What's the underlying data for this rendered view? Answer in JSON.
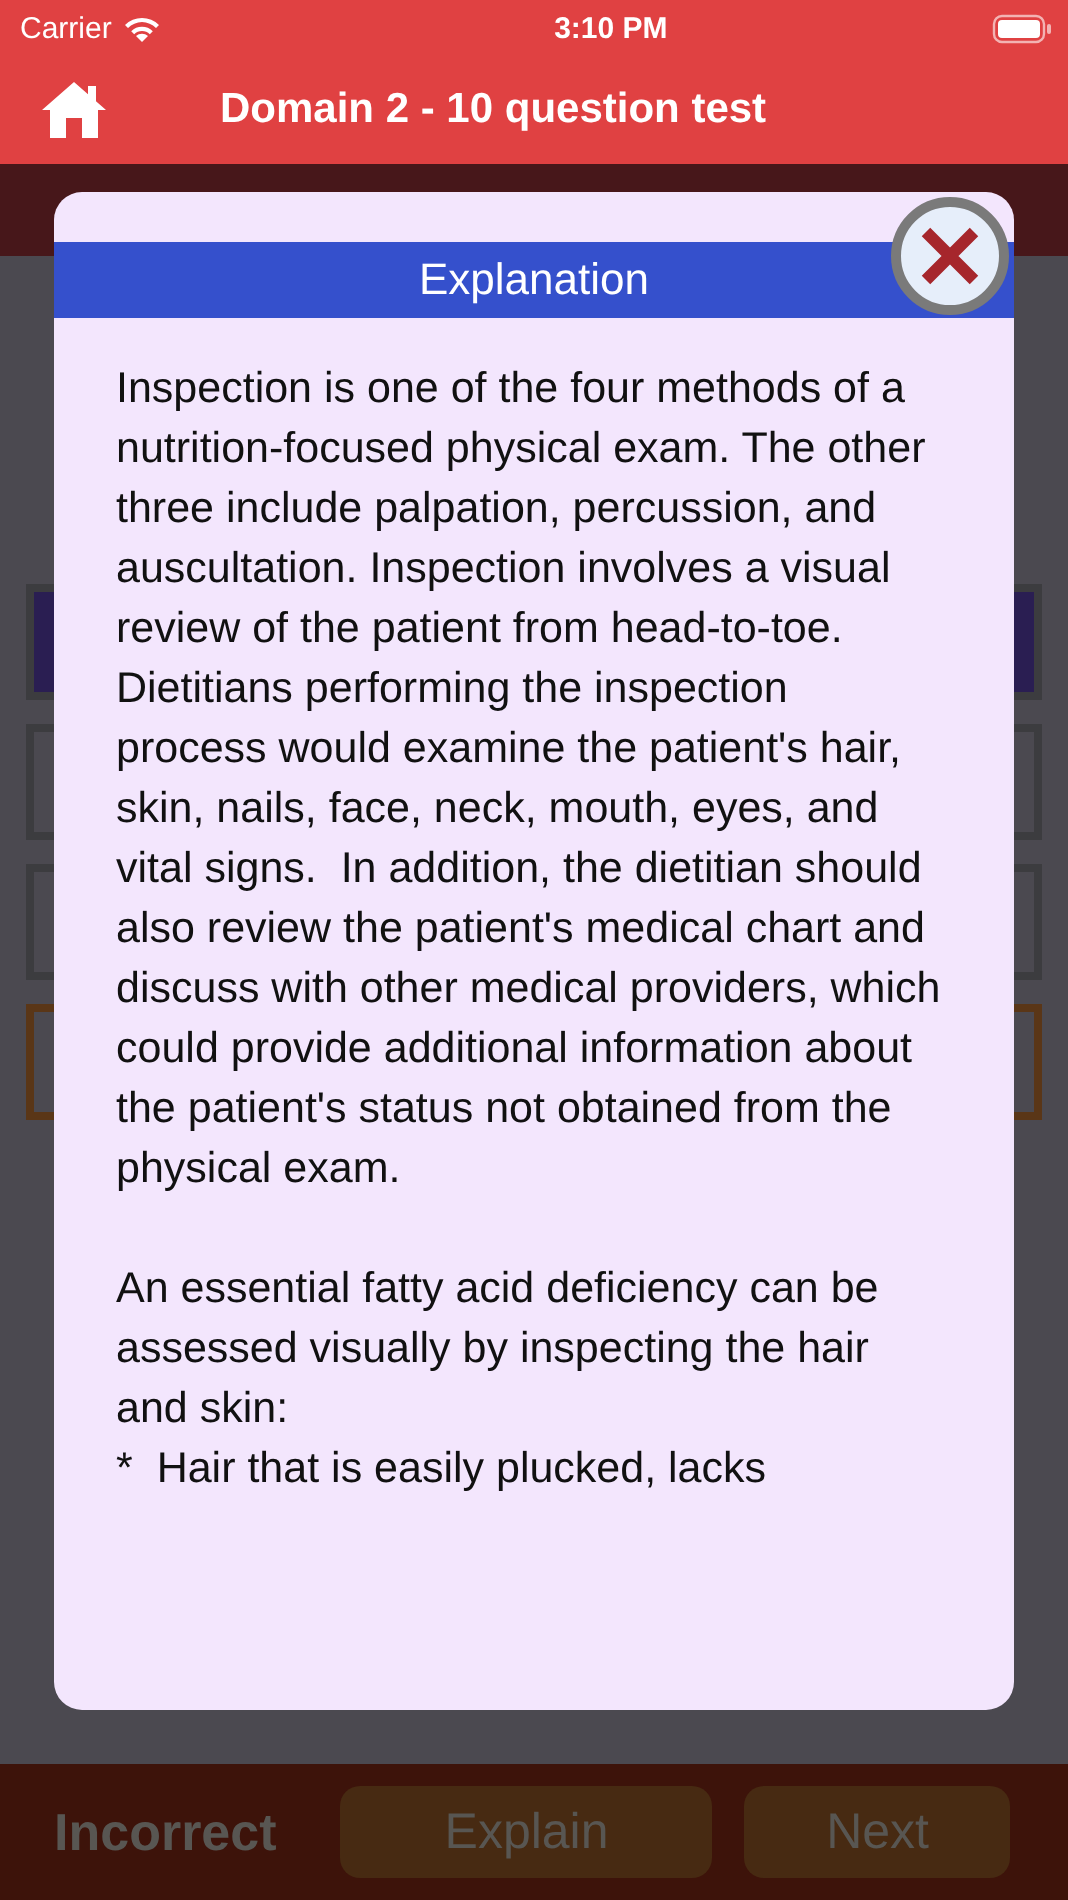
{
  "status_bar": {
    "carrier": "Carrier",
    "time": "3:10 PM"
  },
  "nav": {
    "title": "Domain 2 - 10 question test"
  },
  "answers": [
    {
      "selected": true
    },
    {
      "selected": false
    },
    {
      "selected": false
    },
    {
      "selected": false,
      "kind": "correct"
    }
  ],
  "modal": {
    "title": "Explanation",
    "paragraphs": [
      "Inspection is one of the four methods of a nutrition-focused physical exam. The other three include palpation, percussion, and auscultation. Inspection involves a visual review of the patient from head-to-toe. Dietitians performing the inspection process would examine the patient's hair, skin, nails, face, neck, mouth, eyes, and vital signs.  In addition, the dietitian should also review the patient's medical chart and discuss with other medical providers, which could provide additional information about the patient's status not obtained from the physical exam.",
      "An essential fatty acid deficiency can be assessed visually by inspecting the hair and skin:\n*  Hair that is easily plucked, lacks"
    ]
  },
  "bottom_bar": {
    "result": "Incorrect",
    "buttons": [
      "Explain",
      "Next"
    ]
  }
}
